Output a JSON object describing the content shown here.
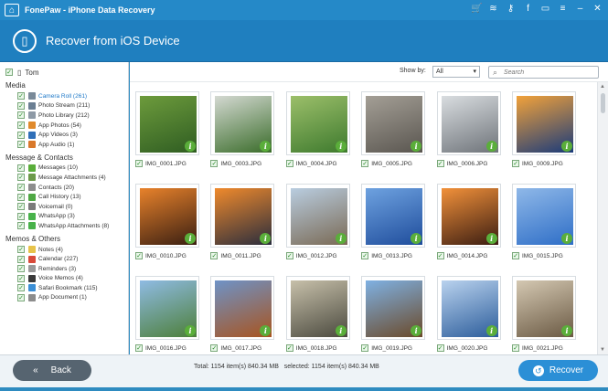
{
  "window": {
    "title": "FonePaw - iPhone Data Recovery",
    "icons": [
      "cart-icon",
      "wifi-icon",
      "key-icon",
      "facebook-icon",
      "chat-icon",
      "menu-icon",
      "minimize-icon",
      "close-icon"
    ]
  },
  "header": {
    "title": "Recover from iOS Device"
  },
  "sidebar": {
    "device": "Tom",
    "sections": [
      {
        "title": "Media",
        "items": [
          {
            "label": "Camera Roll (261)",
            "icon": "camera-icon",
            "color": "#7a8a99",
            "active": true
          },
          {
            "label": "Photo Stream (211)",
            "icon": "photo-stream-icon",
            "color": "#6b7f93"
          },
          {
            "label": "Photo Library (212)",
            "icon": "photo-library-icon",
            "color": "#8e9aa6"
          },
          {
            "label": "App Photos (54)",
            "icon": "app-photos-icon",
            "color": "#e08a2c"
          },
          {
            "label": "App Videos (3)",
            "icon": "app-videos-icon",
            "color": "#2f6fb8"
          },
          {
            "label": "App Audio (1)",
            "icon": "app-audio-icon",
            "color": "#d9782a"
          }
        ]
      },
      {
        "title": "Message & Contacts",
        "items": [
          {
            "label": "Messages (10)",
            "icon": "messages-icon",
            "color": "#5aae3a"
          },
          {
            "label": "Message Attachments (4)",
            "icon": "attachment-icon",
            "color": "#6c9a4a"
          },
          {
            "label": "Contacts (20)",
            "icon": "contacts-icon",
            "color": "#8d8d8d"
          },
          {
            "label": "Call History (13)",
            "icon": "call-history-icon",
            "color": "#4fa844"
          },
          {
            "label": "Voicemail (0)",
            "icon": "voicemail-icon",
            "color": "#7b7b7b"
          },
          {
            "label": "WhatsApp (3)",
            "icon": "whatsapp-icon",
            "color": "#48b24a"
          },
          {
            "label": "WhatsApp Attachments (8)",
            "icon": "whatsapp-attachments-icon",
            "color": "#48b24a"
          }
        ]
      },
      {
        "title": "Memos & Others",
        "items": [
          {
            "label": "Notes (4)",
            "icon": "notes-icon",
            "color": "#e7c34a"
          },
          {
            "label": "Calendar (227)",
            "icon": "calendar-icon",
            "color": "#d94a3a"
          },
          {
            "label": "Reminders (3)",
            "icon": "reminders-icon",
            "color": "#9a9a9a"
          },
          {
            "label": "Voice Memos (4)",
            "icon": "voice-memos-icon",
            "color": "#3a3a3a"
          },
          {
            "label": "Safari Bookmark (115)",
            "icon": "safari-icon",
            "color": "#3b8fd6"
          },
          {
            "label": "App Document (1)",
            "icon": "app-document-icon",
            "color": "#8c8c8c"
          }
        ]
      }
    ]
  },
  "toolbar": {
    "show_by_label": "Show by:",
    "show_by_value": "All",
    "search_placeholder": "Search"
  },
  "gallery": {
    "photos": [
      {
        "name": "IMG_0001.JPG",
        "colors": [
          "#2f5d22",
          "#6d9b3c"
        ]
      },
      {
        "name": "IMG_0003.JPG",
        "colors": [
          "#3b6d2b",
          "#d4d9d2"
        ]
      },
      {
        "name": "IMG_0004.JPG",
        "colors": [
          "#3e7a2e",
          "#9cbf6a"
        ]
      },
      {
        "name": "IMG_0005.JPG",
        "colors": [
          "#5a5650",
          "#a49f96"
        ]
      },
      {
        "name": "IMG_0006.JPG",
        "colors": [
          "#6f747a",
          "#d9dde0"
        ]
      },
      {
        "name": "IMG_0009.JPG",
        "colors": [
          "#1b3b7a",
          "#f2a23a"
        ]
      },
      {
        "name": "IMG_0010.JPG",
        "colors": [
          "#3a1f12",
          "#e8822b"
        ]
      },
      {
        "name": "IMG_0011.JPG",
        "colors": [
          "#2a2d3d",
          "#f08a2c"
        ]
      },
      {
        "name": "IMG_0012.JPG",
        "colors": [
          "#7a6a55",
          "#b9cde0"
        ]
      },
      {
        "name": "IMG_0013.JPG",
        "colors": [
          "#1f4d9c",
          "#6ea2e0"
        ]
      },
      {
        "name": "IMG_0014.JPG",
        "colors": [
          "#3b1d12",
          "#f2913a"
        ]
      },
      {
        "name": "IMG_0015.JPG",
        "colors": [
          "#2e6ec7",
          "#8fb8e8"
        ]
      },
      {
        "name": "IMG_0016.JPG",
        "colors": [
          "#4d7f3a",
          "#8fbbe3"
        ]
      },
      {
        "name": "IMG_0017.JPG",
        "colors": [
          "#a8541f",
          "#6e93c7"
        ]
      },
      {
        "name": "IMG_0018.JPG",
        "colors": [
          "#4b4a3f",
          "#c7c0aa"
        ]
      },
      {
        "name": "IMG_0019.JPG",
        "colors": [
          "#6b4a2a",
          "#7fb1e3"
        ]
      },
      {
        "name": "IMG_0020.JPG",
        "colors": [
          "#2c5d9b",
          "#b9d2ee"
        ]
      },
      {
        "name": "IMG_0021.JPG",
        "colors": [
          "#6b5a44",
          "#d4c8b2"
        ]
      }
    ]
  },
  "footer": {
    "back_label": "Back",
    "total_text": "Total: 1154 item(s) 840.34 MB",
    "selected_text": "selected: 1154 item(s) 840.34 MB",
    "recover_label": "Recover"
  }
}
